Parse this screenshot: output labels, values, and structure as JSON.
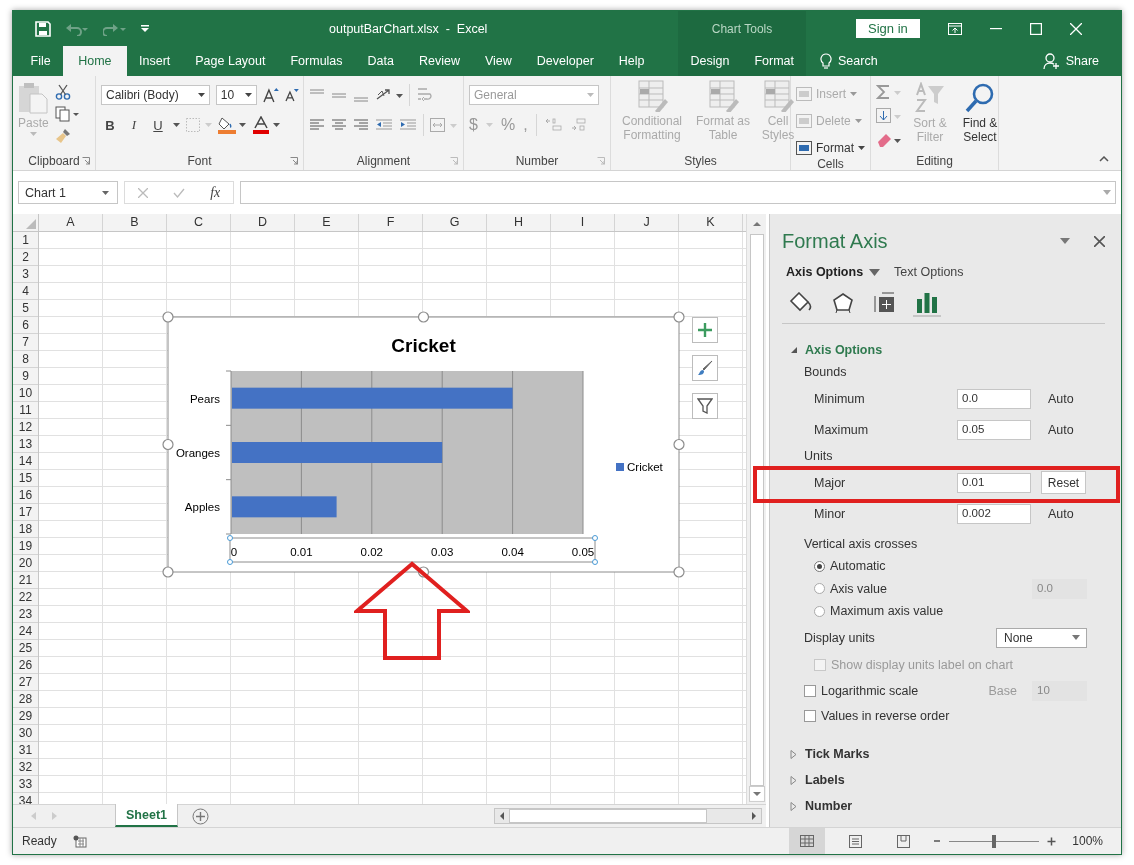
{
  "window": {
    "title": "outputBarChart.xlsx  -  Excel",
    "context_group": "Chart Tools",
    "sign_in": "Sign in"
  },
  "tabs": [
    {
      "label": "File",
      "kind": "normal",
      "selected": false
    },
    {
      "label": "Home",
      "kind": "normal",
      "selected": true
    },
    {
      "label": "Insert",
      "kind": "normal",
      "selected": false
    },
    {
      "label": "Page Layout",
      "kind": "normal",
      "selected": false
    },
    {
      "label": "Formulas",
      "kind": "normal",
      "selected": false
    },
    {
      "label": "Data",
      "kind": "normal",
      "selected": false
    },
    {
      "label": "Review",
      "kind": "normal",
      "selected": false
    },
    {
      "label": "View",
      "kind": "normal",
      "selected": false
    },
    {
      "label": "Developer",
      "kind": "normal",
      "selected": false
    },
    {
      "label": "Help",
      "kind": "normal",
      "selected": false
    },
    {
      "label": "Design",
      "kind": "contextual",
      "selected": false
    },
    {
      "label": "Format",
      "kind": "contextual",
      "selected": false
    }
  ],
  "tell_me": "Search",
  "share": "Share",
  "ribbon": {
    "clipboard": {
      "label": "Clipboard",
      "paste": "Paste"
    },
    "font": {
      "label": "Font",
      "name": "Calibri (Body)",
      "size": "10",
      "bold": "B",
      "italic": "I",
      "underline": "U"
    },
    "alignment": {
      "label": "Alignment"
    },
    "number": {
      "label": "Number",
      "format": "General",
      "currency": "$",
      "percent": "%",
      "comma": ","
    },
    "styles": {
      "label": "Styles",
      "buttons": [
        {
          "label": "Conditional Formatting",
          "disabled": true
        },
        {
          "label": "Format as Table",
          "disabled": true
        },
        {
          "label": "Cell Styles",
          "disabled": true
        }
      ]
    },
    "cells": {
      "label": "Cells",
      "buttons": [
        {
          "label": "Insert",
          "disabled": true
        },
        {
          "label": "Delete",
          "disabled": true
        },
        {
          "label": "Format",
          "disabled": false
        }
      ]
    },
    "editing": {
      "label": "Editing",
      "buttons": [
        {
          "label": "Sort & Filter",
          "kind": "sort",
          "disabled": true
        },
        {
          "label": "Find & Select",
          "kind": "find",
          "disabled": false
        }
      ]
    }
  },
  "formula_bar": {
    "name_box": "Chart 1",
    "function_label": "fx"
  },
  "grid": {
    "columns": [
      "A",
      "B",
      "C",
      "D",
      "E",
      "F",
      "G",
      "H",
      "I",
      "J",
      "K"
    ],
    "rows": [
      "1",
      "2",
      "3",
      "4",
      "5",
      "6",
      "7",
      "8",
      "9",
      "10",
      "11",
      "12",
      "13",
      "14",
      "15",
      "16",
      "17",
      "18",
      "19",
      "20",
      "21",
      "22",
      "23",
      "24",
      "25",
      "26",
      "27",
      "28",
      "29",
      "30",
      "31",
      "32",
      "33",
      "34"
    ]
  },
  "chart": {
    "selected": true,
    "axis_selected": true,
    "chart_data": {
      "type": "bar",
      "orientation": "horizontal",
      "title": "Cricket",
      "categories": [
        "Pears",
        "Oranges",
        "Apples"
      ],
      "series": [
        {
          "name": "Cricket",
          "color": "#4472c4",
          "values": [
            0.04,
            0.03,
            0.015
          ]
        }
      ],
      "xlim": [
        0,
        0.05
      ],
      "xticks": [
        0,
        0.01,
        0.02,
        0.03,
        0.04,
        0.05
      ],
      "grid": true
    }
  },
  "format_pane": {
    "title": "Format Axis",
    "tabs": [
      {
        "label": "Axis Options",
        "selected": true
      },
      {
        "label": "Text Options",
        "selected": false
      }
    ],
    "icon_tabs": [
      {
        "kind": "fill",
        "selected": false
      },
      {
        "kind": "effects",
        "selected": false
      },
      {
        "kind": "size",
        "selected": false
      },
      {
        "kind": "axis",
        "selected": true
      }
    ],
    "section": {
      "label": "Axis Options",
      "expanded": true
    },
    "groups": [
      {
        "heading": "Bounds",
        "fields": [
          {
            "label": "Minimum",
            "value": "0.0",
            "action": "Auto",
            "kind": "auto"
          },
          {
            "label": "Maximum",
            "value": "0.05",
            "action": "Auto",
            "kind": "auto"
          }
        ]
      },
      {
        "heading": "Units",
        "fields": [
          {
            "label": "Major",
            "value": "0.01",
            "action": "Reset",
            "kind": "reset"
          },
          {
            "label": "Minor",
            "value": "0.002",
            "action": "Auto",
            "kind": "auto"
          }
        ]
      }
    ],
    "crosses": {
      "heading": "Vertical axis crosses",
      "options": [
        {
          "label": "Automatic",
          "selected": true
        },
        {
          "label": "Axis value",
          "selected": false,
          "value": "0.0"
        },
        {
          "label": "Maximum axis value",
          "selected": false
        }
      ]
    },
    "display_units": {
      "label": "Display units",
      "value": "None"
    },
    "checkboxes": [
      {
        "label": "Show display units label on chart",
        "checked": false,
        "disabled": true
      },
      {
        "label": "Logarithmic scale",
        "checked": false,
        "disabled": false,
        "extra_label": "Base",
        "extra_value": "10"
      },
      {
        "label": "Values in reverse order",
        "checked": false,
        "disabled": false
      }
    ],
    "collapsed_sections": [
      {
        "label": "Tick Marks",
        "expanded": false
      },
      {
        "label": "Labels",
        "expanded": false
      },
      {
        "label": "Number",
        "expanded": false
      }
    ]
  },
  "sheet_tabs": [
    {
      "label": "Sheet1",
      "selected": true
    }
  ],
  "status_bar": {
    "text": "Ready",
    "views": [
      {
        "kind": "normal",
        "selected": true
      },
      {
        "kind": "page_layout",
        "selected": false
      },
      {
        "kind": "page_break",
        "selected": false
      }
    ],
    "zoom": {
      "level": 0.5,
      "reading": "100%"
    }
  }
}
